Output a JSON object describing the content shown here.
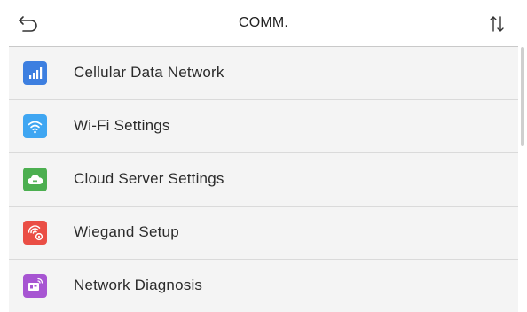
{
  "header": {
    "title": "COMM.",
    "back_icon": "back-arrow-icon",
    "sort_icon": "sort-arrows-icon"
  },
  "menu": {
    "items": [
      {
        "label": "Cellular Data Network",
        "icon": "cellular-signal-icon",
        "color": "#3d7fe0"
      },
      {
        "label": "Wi-Fi Settings",
        "icon": "wifi-icon",
        "color": "#3fa6f2"
      },
      {
        "label": "Cloud Server Settings",
        "icon": "cloud-icon",
        "color": "#4caf50"
      },
      {
        "label": "Wiegand Setup",
        "icon": "wiegand-icon",
        "color": "#ea4e45"
      },
      {
        "label": "Network Diagnosis",
        "icon": "network-diagnosis-icon",
        "color": "#a755d2"
      }
    ]
  }
}
